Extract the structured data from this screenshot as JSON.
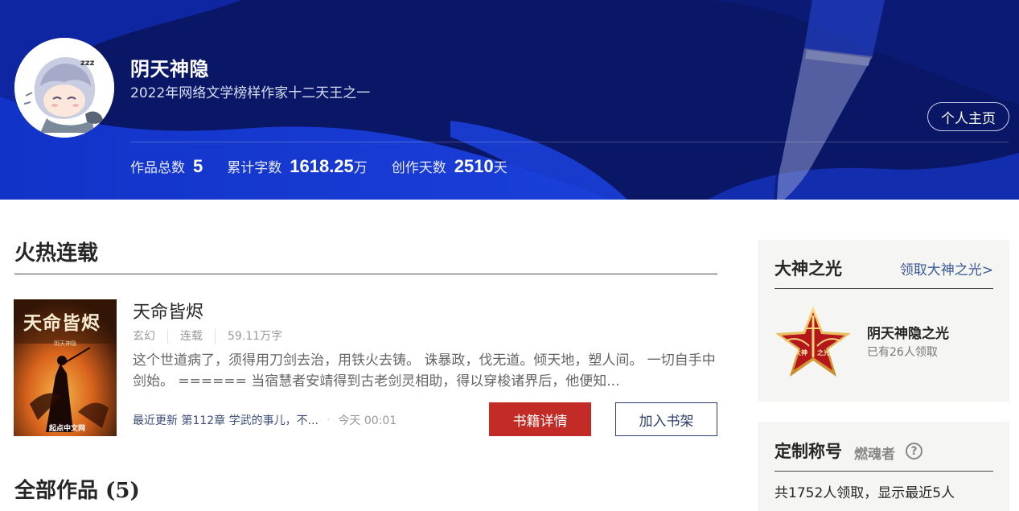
{
  "header": {
    "author_name": "阴天神隐",
    "author_title": "2022年网络文学榜样作家十二天王之一",
    "home_button": "个人主页",
    "stats": [
      {
        "label": "作品总数",
        "value": "5",
        "unit": ""
      },
      {
        "label": "累计字数",
        "value": "1618.25",
        "unit": "万"
      },
      {
        "label": "创作天数",
        "value": "2510",
        "unit": "天"
      }
    ]
  },
  "hot_section": {
    "title": "火热连载",
    "book": {
      "cover_title": "天命皆烬",
      "cover_author": "阴天神隐",
      "cover_publisher": "起点中文网",
      "name": "天命皆烬",
      "tags": [
        "玄幻",
        "连载",
        "59.11万字"
      ],
      "description": "这个世道病了，须得用刀剑去治，用铁火去铸。 诛暴政，伐无道。倾天地，塑人间。 一切自手中剑始。 ====== 当宿慧者安靖得到古老剑灵相助，得以穿梭诸界后，他便知...",
      "update_label": "最近更新 第112章 学武的事儿，不...",
      "update_dot": "·",
      "update_time": "今天 00:01",
      "detail_button": "书籍详情",
      "shelf_button": "加入书架"
    }
  },
  "all_works": {
    "title": "全部作品 (5)"
  },
  "sidebar": {
    "honor_card": {
      "title": "大神之光",
      "link": "领取大神之光>",
      "badge_text_left": "大神",
      "badge_text_right": "之光",
      "badge_name": "阴天神隐之光",
      "badge_count": "已有26人领取"
    },
    "custom_card": {
      "title": "定制称号",
      "subtitle": "燃魂者",
      "help_icon": "?",
      "summary": "共1752人领取，显示最近5人"
    }
  },
  "colors": {
    "banner_bg": "#0a1766",
    "primary_red": "#c22b26",
    "link_blue": "#3c5a99",
    "card_bg": "#f5f5f3"
  },
  "icons": {
    "avatar": "anime-avatar",
    "badge": "star-badge-icon",
    "help": "question-circle-icon",
    "banner_decor": "fountain-pen-icon"
  }
}
